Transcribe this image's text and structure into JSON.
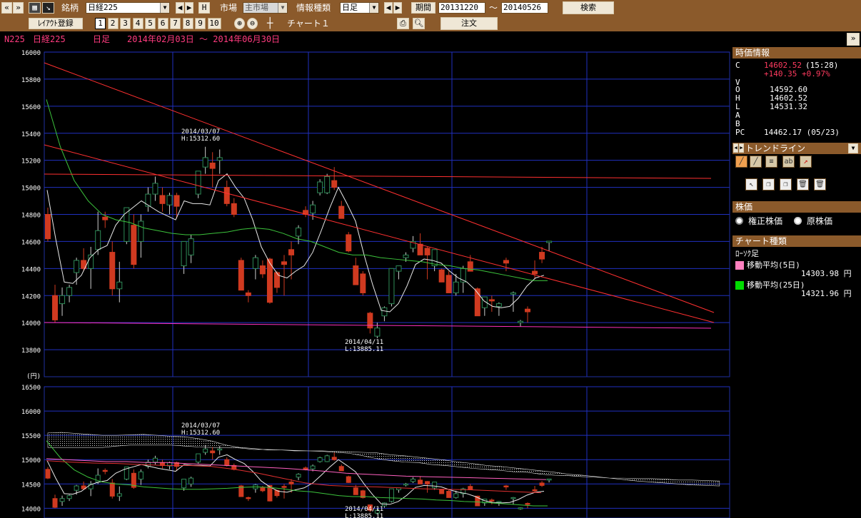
{
  "toolbar": {
    "meigara_label": "銘柄",
    "meigara_value": "日経225",
    "h_button": "H",
    "market_label": "市場",
    "market_value": "主市場",
    "info_type_label": "情報種類",
    "info_type_value": "日足",
    "period_button": "期間",
    "period_from": "20131220",
    "period_sep": "〜",
    "period_to": "20140526",
    "search_button": "検索",
    "layout_button": "ﾚｲｱｳﾄ登録",
    "layout_numbers": [
      "1",
      "2",
      "3",
      "4",
      "5",
      "6",
      "7",
      "8",
      "9",
      "10"
    ],
    "chart_name": "チャート１",
    "order_button": "注文"
  },
  "info_line": {
    "code": "N225",
    "name": "日経225",
    "type": "日足",
    "range": "2014年02月03日 〜 2014年06月30日"
  },
  "side": {
    "price_header": "時価情報",
    "c_label": "C",
    "c_value": "14602.52",
    "c_time": "(15:28)",
    "change": "+140.35 +0.97%",
    "v_label": "V",
    "o_label": "O",
    "o_value": "14592.60",
    "h_label": "H",
    "h_value": "14602.52",
    "l_label": "L",
    "l_value": "14531.32",
    "a_label": "A",
    "b_label": "B",
    "pc_label": "PC",
    "pc_value": "14462.17 (05/23)",
    "trend_header": "トレンドライン",
    "kabuka_header": "株価",
    "radio1": "権正株価",
    "radio2": "原株価",
    "chart_type_header": "チャート種類",
    "candle_label": "ﾛｰｿｸ足",
    "ma5_label": "移動平均(5日)",
    "ma5_value": "14303.98 円",
    "ma25_label": "移動平均(25日)",
    "ma25_value": "14321.96 円",
    "ma5_color": "#ff80c0",
    "ma25_color": "#00dd00"
  },
  "chart_data": {
    "type": "candlestick",
    "upper": {
      "ylim": [
        13600,
        16000
      ],
      "ticks": [
        "16000",
        "15800",
        "15600",
        "15400",
        "15200",
        "15000",
        "14800",
        "14600",
        "14400",
        "14200",
        "14000",
        "13800"
      ],
      "unit": "(円)",
      "annotations": [
        {
          "text1": "2014/03/07",
          "text2": "H:15312.60"
        },
        {
          "text1": "2014/04/11",
          "text2": "L:13885.11"
        }
      ]
    },
    "lower": {
      "ylim": [
        13800,
        16500
      ],
      "ticks": [
        "16500",
        "16000",
        "15500",
        "15000",
        "14500",
        "14000"
      ],
      "annotations": [
        {
          "text1": "2014/03/07",
          "text2": "H:15312.60"
        },
        {
          "text1": "2014/04/11",
          "text2": "L:13885.11"
        }
      ]
    },
    "candles": [
      [
        14800,
        14850,
        14600,
        14620
      ],
      [
        14200,
        14280,
        14000,
        14020
      ],
      [
        14140,
        14260,
        14050,
        14200
      ],
      [
        14200,
        14280,
        14150,
        14260
      ],
      [
        14370,
        14480,
        14280,
        14460
      ],
      [
        14460,
        14550,
        14380,
        14400
      ],
      [
        14400,
        14560,
        14250,
        14500
      ],
      [
        14540,
        14820,
        14500,
        14680
      ],
      [
        14780,
        14820,
        14700,
        14760
      ],
      [
        14520,
        14600,
        14200,
        14250
      ],
      [
        14250,
        14450,
        14150,
        14300
      ],
      [
        14600,
        14850,
        14580,
        14850
      ],
      [
        14720,
        14800,
        14400,
        14430
      ],
      [
        14600,
        14800,
        14480,
        14750
      ],
      [
        14860,
        15000,
        14820,
        14950
      ],
      [
        14950,
        15080,
        14900,
        15030
      ],
      [
        14940,
        15000,
        14820,
        14880
      ],
      [
        14870,
        14960,
        14800,
        14940
      ],
      [
        14940,
        14960,
        14770,
        14860
      ],
      [
        14420,
        14500,
        14360,
        14600
      ],
      [
        14500,
        14650,
        14440,
        14620
      ],
      [
        14950,
        15100,
        14920,
        15120
      ],
      [
        15150,
        15300,
        15100,
        15220
      ],
      [
        15180,
        15260,
        15000,
        15140
      ],
      [
        15200,
        15280,
        15100,
        15220
      ],
      [
        15000,
        15050,
        14860,
        14880
      ],
      [
        14880,
        14920,
        14780,
        14800
      ],
      [
        14460,
        14480,
        14250,
        14240
      ],
      [
        14220,
        14240,
        14150,
        14200
      ],
      [
        14400,
        14500,
        14320,
        14480
      ],
      [
        14420,
        14460,
        14330,
        14360
      ],
      [
        14470,
        14480,
        14140,
        14150
      ],
      [
        14370,
        14380,
        14220,
        14260
      ],
      [
        14450,
        14500,
        14200,
        14430
      ],
      [
        14540,
        14600,
        14320,
        14500
      ],
      [
        14640,
        14720,
        14580,
        14700
      ],
      [
        14830,
        14860,
        14780,
        14800
      ],
      [
        14810,
        14900,
        14760,
        14870
      ],
      [
        14960,
        15060,
        14940,
        15040
      ],
      [
        14960,
        15100,
        14950,
        15080
      ],
      [
        15050,
        15150,
        14980,
        15000
      ],
      [
        14860,
        14900,
        14780,
        14770
      ],
      [
        14650,
        14670,
        14520,
        14530
      ],
      [
        14420,
        14480,
        14290,
        14280
      ],
      [
        14360,
        14380,
        14200,
        14220
      ],
      [
        14070,
        14080,
        13920,
        13960
      ],
      [
        13900,
        14000,
        13885,
        13960
      ],
      [
        14050,
        14120,
        14010,
        14110
      ],
      [
        14140,
        14300,
        14120,
        14400
      ],
      [
        14380,
        14400,
        14320,
        14420
      ],
      [
        14480,
        14520,
        14450,
        14500
      ],
      [
        14550,
        14640,
        14520,
        14600
      ],
      [
        14580,
        14660,
        14500,
        14500
      ],
      [
        14550,
        14560,
        14320,
        14500
      ],
      [
        14420,
        14520,
        14380,
        14540
      ],
      [
        14390,
        14400,
        14320,
        14300
      ],
      [
        14350,
        14380,
        14250,
        14220
      ],
      [
        14220,
        14360,
        14200,
        14300
      ],
      [
        14300,
        14420,
        14220,
        14400
      ],
      [
        14450,
        14500,
        14400,
        14380
      ],
      [
        14250,
        14260,
        14050,
        14050
      ],
      [
        14110,
        14180,
        14050,
        14190
      ],
      [
        14170,
        14200,
        14080,
        14160
      ],
      [
        14120,
        14150,
        14050,
        14140
      ],
      [
        14460,
        14480,
        14380,
        14440
      ],
      [
        14210,
        14230,
        14080,
        14220
      ],
      [
        14000,
        14020,
        13970,
        14010
      ],
      [
        14100,
        14120,
        14000,
        14080
      ],
      [
        14380,
        14460,
        14320,
        14360
      ],
      [
        14520,
        14560,
        14440,
        14470
      ],
      [
        14592,
        14602,
        14531,
        14602
      ]
    ],
    "ma5": [
      14980,
      14620,
      14300,
      14290,
      14350,
      14480,
      14540,
      14570,
      14720,
      14800,
      14850,
      14900,
      14860,
      14820,
      14790,
      14760,
      14900,
      14880,
      14880,
      14870,
      15050,
      15100,
      15000,
      14920,
      14760,
      14560,
      14440,
      14350,
      14330,
      14380,
      14420,
      14520,
      14680,
      14850,
      15000,
      14880,
      14750,
      14500,
      14280,
      14090,
      14080,
      14140,
      14270,
      14430,
      14470,
      14460,
      14440,
      14380,
      14330,
      14300,
      14240,
      14160,
      14120,
      14110,
      14120,
      14180,
      14270,
      14330,
      14350
    ],
    "ma25": [
      15650,
      15300,
      15050,
      14900,
      14800,
      14760,
      14740,
      14700,
      14680,
      14660,
      14650,
      14650,
      14660,
      14670,
      14690,
      14700,
      14690,
      14660,
      14620,
      14600,
      14560,
      14520,
      14500,
      14500,
      14480,
      14470,
      14460,
      14450,
      14430,
      14420,
      14400,
      14390,
      14370,
      14350,
      14330,
      14310,
      14310
    ]
  }
}
